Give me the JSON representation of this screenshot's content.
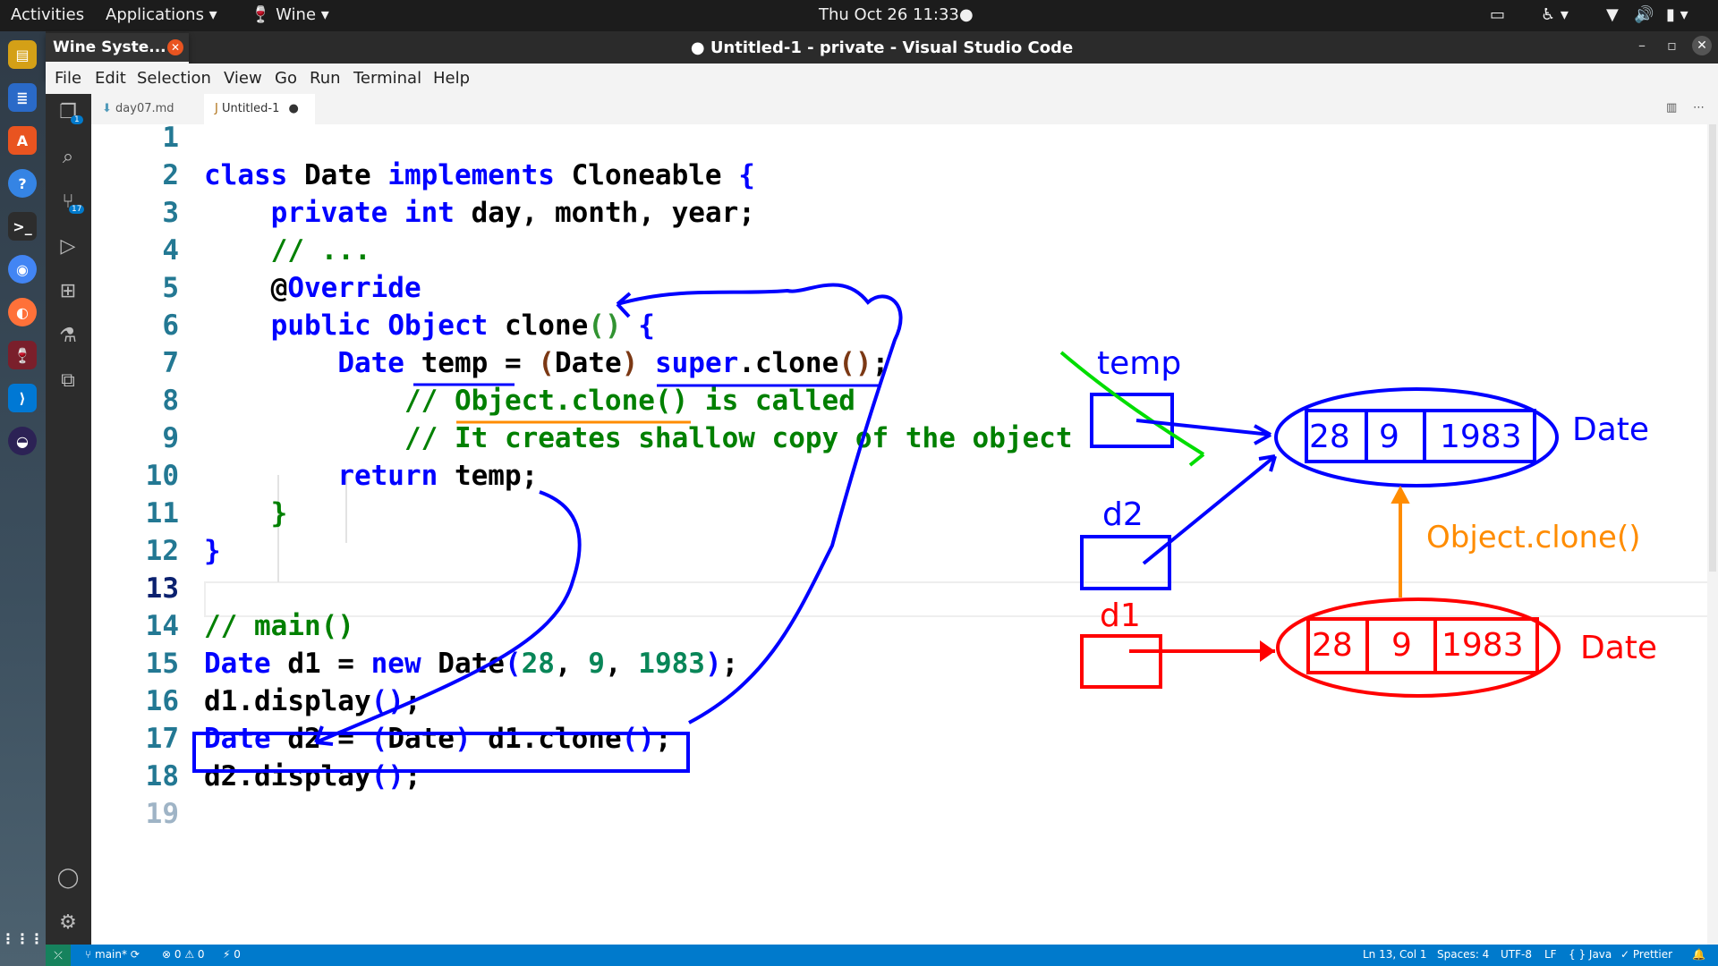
{
  "topbar": {
    "activities": "Activities",
    "applications": "Applications ▾",
    "wine": "🍷 Wine ▾",
    "clock": "Thu Oct 26  11:33"
  },
  "window": {
    "title": "● Untitled-1 - private - Visual Studio Code",
    "popup_title": "Wine Syste..."
  },
  "menu": [
    "File",
    "Edit",
    "Selection",
    "View",
    "Go",
    "Run",
    "Terminal",
    "Help"
  ],
  "tabs": [
    {
      "label": "day07.md"
    },
    {
      "label": "Untitled-1",
      "dirty": "●"
    }
  ],
  "activity_badges": {
    "explorer": "1",
    "scm": "17"
  },
  "code": [
    {
      "n": "1",
      "t": ""
    },
    {
      "n": "2",
      "t": "class Date implements Cloneable {"
    },
    {
      "n": "3",
      "t": "    private int day, month, year;"
    },
    {
      "n": "4",
      "t": "    // ..."
    },
    {
      "n": "5",
      "t": "    @Override"
    },
    {
      "n": "6",
      "t": "    public Object clone() {"
    },
    {
      "n": "7",
      "t": "        Date temp = (Date) super.clone();"
    },
    {
      "n": "8",
      "t": "            // Object.clone() is called"
    },
    {
      "n": "9",
      "t": "            // It creates shallow copy of the object"
    },
    {
      "n": "10",
      "t": "        return temp;"
    },
    {
      "n": "11",
      "t": "    }"
    },
    {
      "n": "12",
      "t": "}"
    },
    {
      "n": "13",
      "t": ""
    },
    {
      "n": "14",
      "t": "// main()"
    },
    {
      "n": "15",
      "t": "Date d1 = new Date(28, 9, 1983);"
    },
    {
      "n": "16",
      "t": "d1.display();"
    },
    {
      "n": "17",
      "t": "Date d2 = (Date) d1.clone();"
    },
    {
      "n": "18",
      "t": "d2.display();"
    },
    {
      "n": "19",
      "t": ""
    }
  ],
  "annotations": {
    "temp_label": "temp",
    "d2_label": "d2",
    "d1_label": "d1",
    "blue_obj": [
      "28",
      "9",
      "1983"
    ],
    "blue_date": "Date",
    "red_obj": [
      "28",
      "9",
      "1983"
    ],
    "red_date": "Date",
    "clone_label": "Object.clone()"
  },
  "colors": {
    "blue": "#0000ff",
    "red": "#ff0000",
    "orange": "#ff8c00",
    "green": "#00dd00",
    "status": "#007acc"
  },
  "status": {
    "branch": "main*",
    "problems": "⊗ 0 ⚠ 0",
    "ports": "⚡ 0",
    "position": "Ln 13, Col 1",
    "spaces": "Spaces: 4",
    "encoding": "UTF-8",
    "eol": "LF",
    "language": "{ } Java",
    "prettier": "✓ Prettier"
  }
}
